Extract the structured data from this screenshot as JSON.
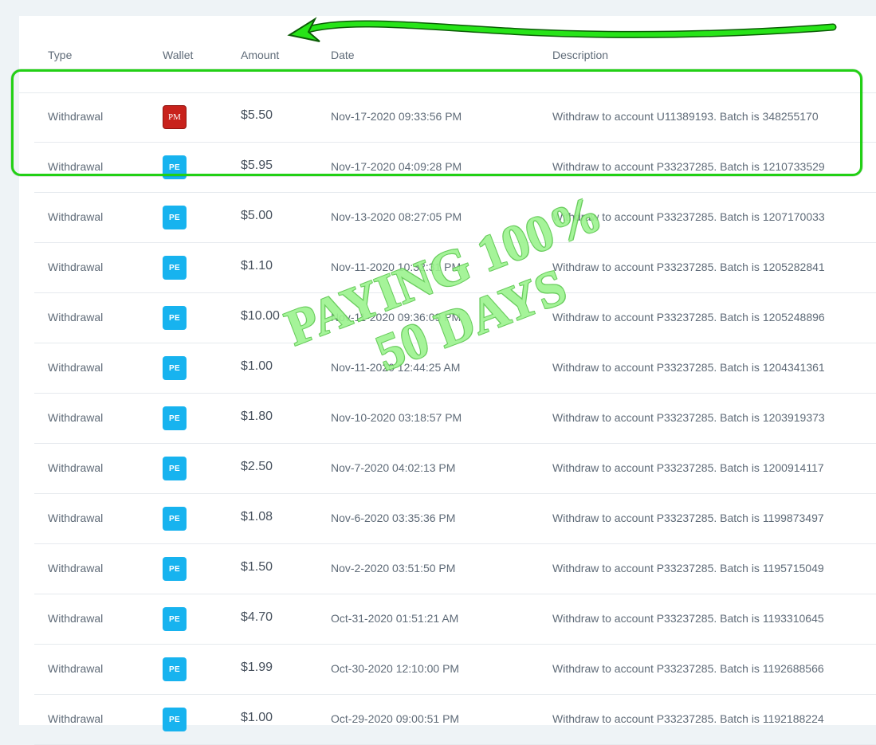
{
  "table": {
    "headers": {
      "type": "Type",
      "wallet": "Wallet",
      "amount": "Amount",
      "date": "Date",
      "description": "Description"
    },
    "rows": [
      {
        "type": "Withdrawal",
        "wallet": "PM",
        "amount": "$5.50",
        "date": "Nov-17-2020 09:33:56 PM",
        "description": "Withdraw to account U11389193. Batch is 348255170"
      },
      {
        "type": "Withdrawal",
        "wallet": "PE",
        "amount": "$5.95",
        "date": "Nov-17-2020 04:09:28 PM",
        "description": "Withdraw to account P33237285. Batch is 1210733529"
      },
      {
        "type": "Withdrawal",
        "wallet": "PE",
        "amount": "$5.00",
        "date": "Nov-13-2020 08:27:05 PM",
        "description": "Withdraw to account P33237285. Batch is 1207170033"
      },
      {
        "type": "Withdrawal",
        "wallet": "PE",
        "amount": "$1.10",
        "date": "Nov-11-2020 10:32:31 PM",
        "description": "Withdraw to account P33237285. Batch is 1205282841"
      },
      {
        "type": "Withdrawal",
        "wallet": "PE",
        "amount": "$10.00",
        "date": "Nov-11-2020 09:36:09 PM",
        "description": "Withdraw to account P33237285. Batch is 1205248896"
      },
      {
        "type": "Withdrawal",
        "wallet": "PE",
        "amount": "$1.00",
        "date": "Nov-11-2020 12:44:25 AM",
        "description": "Withdraw to account P33237285. Batch is 1204341361"
      },
      {
        "type": "Withdrawal",
        "wallet": "PE",
        "amount": "$1.80",
        "date": "Nov-10-2020 03:18:57 PM",
        "description": "Withdraw to account P33237285. Batch is 1203919373"
      },
      {
        "type": "Withdrawal",
        "wallet": "PE",
        "amount": "$2.50",
        "date": "Nov-7-2020 04:02:13 PM",
        "description": "Withdraw to account P33237285. Batch is 1200914117"
      },
      {
        "type": "Withdrawal",
        "wallet": "PE",
        "amount": "$1.08",
        "date": "Nov-6-2020 03:35:36 PM",
        "description": "Withdraw to account P33237285. Batch is 1199873497"
      },
      {
        "type": "Withdrawal",
        "wallet": "PE",
        "amount": "$1.50",
        "date": "Nov-2-2020 03:51:50 PM",
        "description": "Withdraw to account P33237285. Batch is 1195715049"
      },
      {
        "type": "Withdrawal",
        "wallet": "PE",
        "amount": "$4.70",
        "date": "Oct-31-2020 01:51:21 AM",
        "description": "Withdraw to account P33237285. Batch is 1193310645"
      },
      {
        "type": "Withdrawal",
        "wallet": "PE",
        "amount": "$1.99",
        "date": "Oct-30-2020 12:10:00 PM",
        "description": "Withdraw to account P33237285. Batch is 1192688566"
      },
      {
        "type": "Withdrawal",
        "wallet": "PE",
        "amount": "$1.00",
        "date": "Oct-29-2020 09:00:51 PM",
        "description": "Withdraw to account P33237285. Batch is 1192188224"
      }
    ]
  },
  "overlay": {
    "watermark_line1": "PAYING 100%",
    "watermark_line2": "50 DAYS",
    "highlight_color": "#22d015",
    "watermark_color": "#9cf38f"
  },
  "wallet_colors": {
    "PE": "#17b3ef",
    "PM": "#c8221c"
  }
}
